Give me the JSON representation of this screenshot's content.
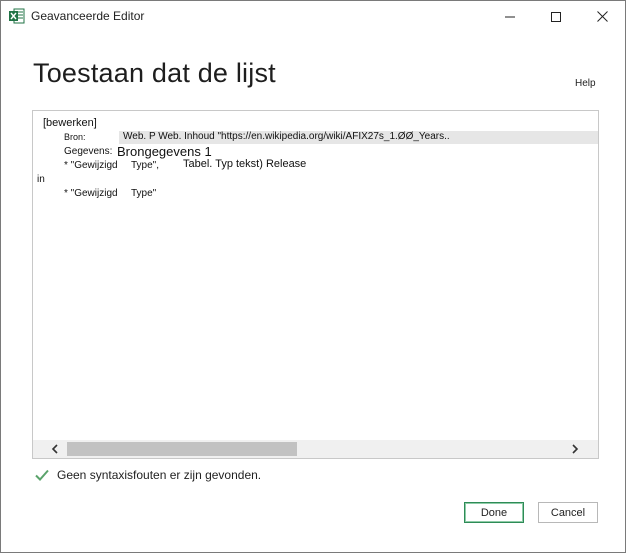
{
  "window": {
    "title": "Geavanceerde Editor",
    "icon": "excel-icon"
  },
  "header": {
    "title": "Toestaan dat de lijst",
    "help": "Help"
  },
  "editor": {
    "lines": {
      "l1": "[bewerken]",
      "l2_key": "Bron:",
      "l2_val": "Web. P Web. Inhoud \"https://en.wikipedia.org/wiki/AFIX27s_1.ØØ_Years..",
      "l3_key": "Gegevens:",
      "l3_val": "Brongegevens 1",
      "l4_a": "* \"Gewijzigd",
      "l4_b": "Type\",",
      "l4_c": "Tabel. Typ tekst) Release",
      "l5": "in",
      "l6_a": "* \"Gewijzigd",
      "l6_b": "Type\""
    }
  },
  "status": {
    "text": "Geen syntaxisfouten er zijn gevonden."
  },
  "buttons": {
    "done": "Done",
    "cancel": "Cancel"
  },
  "colors": {
    "excel_green": "#217346",
    "check_green": "#5aa36b",
    "done_border": "#2e8b57"
  }
}
